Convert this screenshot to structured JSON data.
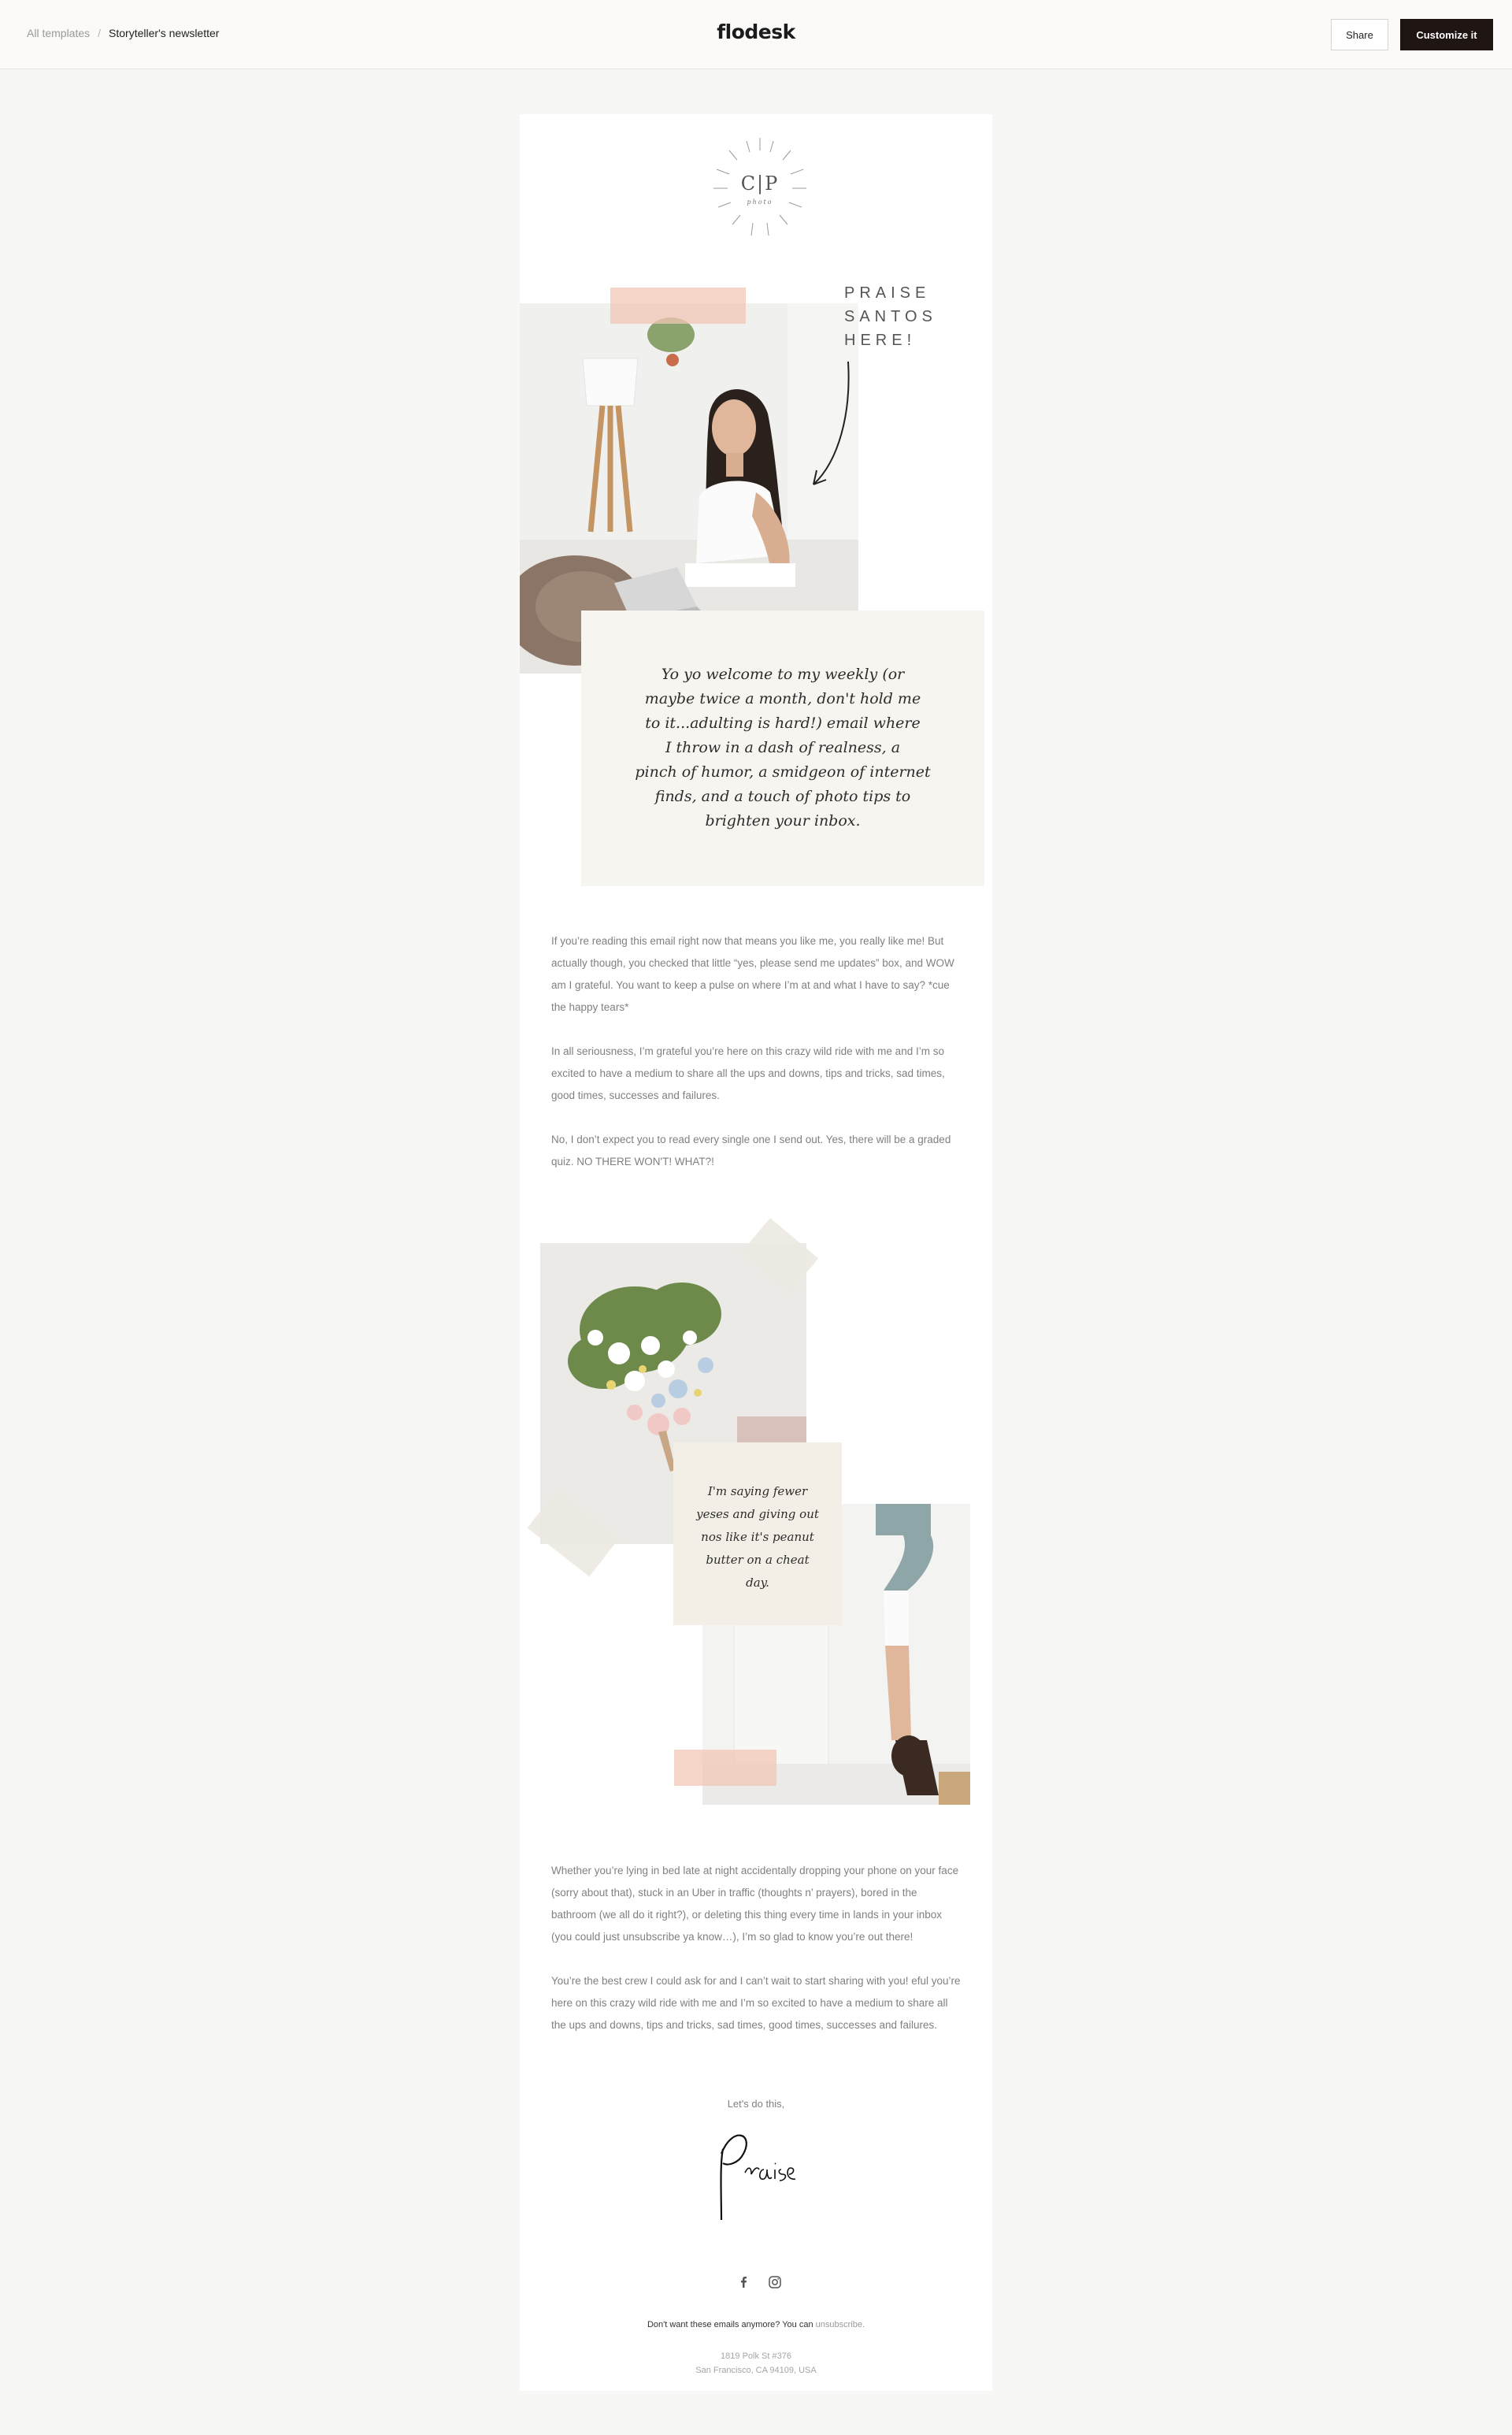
{
  "topbar": {
    "breadcrumb_root": "All templates",
    "breadcrumb_separator": "/",
    "breadcrumb_current": "Storyteller's newsletter",
    "brand": "flodesk",
    "share_label": "Share",
    "customize_label": "Customize it"
  },
  "email": {
    "logo": {
      "monogram": "C|P",
      "subtitle": "photo"
    },
    "hero": {
      "callout_lines": [
        "PRAISE",
        "SANTOS",
        "HERE!"
      ],
      "note_lines": [
        "Yo yo welcome to my weekly (or",
        "maybe twice a month, don't hold me",
        "to it...adulting is hard!) email where",
        "I throw in a dash of realness, a",
        "pinch of humor, a smidgeon of internet",
        "finds, and a touch of photo tips to",
        "brighten your inbox."
      ]
    },
    "paragraphs_top": [
      "If you’re reading this email right now that means you like me, you really like me! But actually though, you checked that little “yes, please send me updates” box, and WOW am I grateful. You want to keep a pulse on where I’m at and what I have to say? *cue the happy tears*",
      "In all seriousness, I’m grateful you’re here on this crazy wild ride with me and I’m so excited to have a medium to share all the ups and downs, tips and tricks, sad times, good times, successes and failures.",
      "No, I don’t expect you to read every single one I send out. Yes, there will be a graded quiz. NO THERE WON'T! WHAT?!"
    ],
    "collage_note_lines": [
      "I'm saying fewer",
      "yeses and giving out",
      "nos like it's peanut",
      "butter on a cheat",
      "day."
    ],
    "paragraphs_bottom": [
      "Whether you’re lying in bed late at night accidentally dropping your phone on your face (sorry about that), stuck in an Uber in traffic (thoughts n’ prayers), bored in the bathroom (we all do it right?), or deleting this thing every time in lands in your inbox (you could just unsubscribe ya know…), I’m so glad to know you’re out there!",
      "You’re the best crew I could ask for and I can’t wait to start sharing with you! eful you’re here on this crazy wild ride with me and I’m so excited to have a medium to share all the ups and downs, tips and tricks, sad times, good times, successes and failures."
    ],
    "signoff": "Let's do this,",
    "signature_name": "Praise",
    "social_icons": [
      "facebook-icon",
      "instagram-icon"
    ],
    "footer": {
      "unsubscribe_text": "Don't want these emails anymore? You can",
      "unsubscribe_link": "unsubscribe.",
      "address_line1": "1819 Polk St #376",
      "address_line2": "San Francisco, CA 94109, USA"
    }
  },
  "colors": {
    "page_bg": "#f7f7f6",
    "topbar_bg": "#fbfaf8",
    "primary_button": "#1f1513",
    "tape_pink": "#f0c7b6",
    "note_bg": "#f7f5f0"
  }
}
